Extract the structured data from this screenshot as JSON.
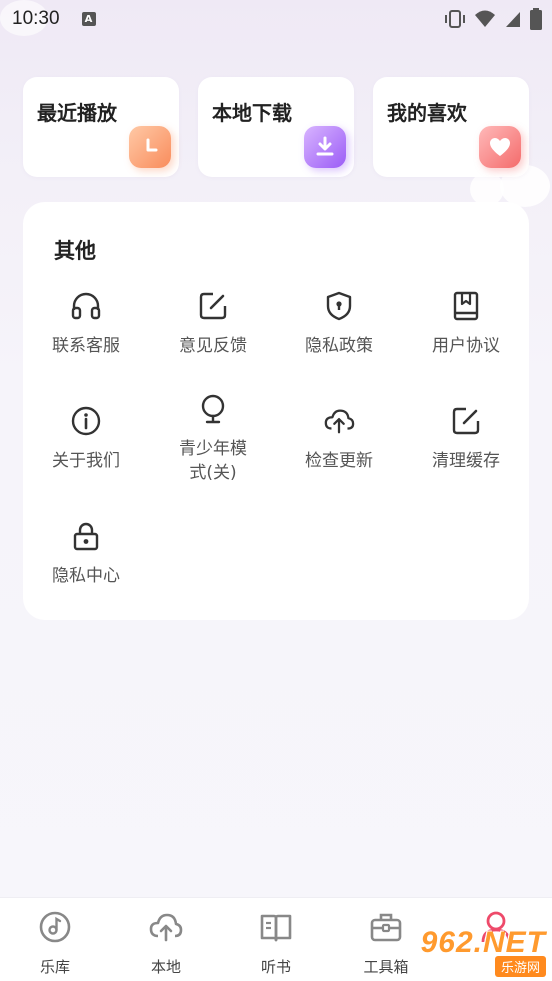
{
  "status_bar": {
    "time": "10:30",
    "notification_badge": "A"
  },
  "quick_cards": [
    {
      "label": "最近播放",
      "icon": "clock-icon",
      "color": "#f98c5c"
    },
    {
      "label": "本地下载",
      "icon": "download-icon",
      "color": "#9b5cf6"
    },
    {
      "label": "我的喜欢",
      "icon": "heart-icon",
      "color": "#f46b6b"
    }
  ],
  "other": {
    "title": "其他",
    "items": [
      {
        "label": "联系客服",
        "icon": "headphones-icon"
      },
      {
        "label": "意见反馈",
        "icon": "edit-icon"
      },
      {
        "label": "隐私政策",
        "icon": "shield-icon"
      },
      {
        "label": "用户协议",
        "icon": "book-icon"
      },
      {
        "label": "关于我们",
        "icon": "info-icon"
      },
      {
        "label": "青少年模式(关)",
        "icon": "youth-icon"
      },
      {
        "label": "检查更新",
        "icon": "cloud-upload-icon"
      },
      {
        "label": "清理缓存",
        "icon": "edit-icon"
      },
      {
        "label": "隐私中心",
        "icon": "lock-icon"
      }
    ]
  },
  "bottom_nav": [
    {
      "label": "乐库",
      "icon": "music-disc-icon"
    },
    {
      "label": "本地",
      "icon": "cloud-upload-icon"
    },
    {
      "label": "听书",
      "icon": "open-book-icon"
    },
    {
      "label": "工具箱",
      "icon": "toolbox-icon"
    },
    {
      "label": "",
      "icon": "user-icon",
      "active_color": "#ee4a6a"
    }
  ],
  "watermark": {
    "brand": "962.NET",
    "sub": "乐游网"
  }
}
